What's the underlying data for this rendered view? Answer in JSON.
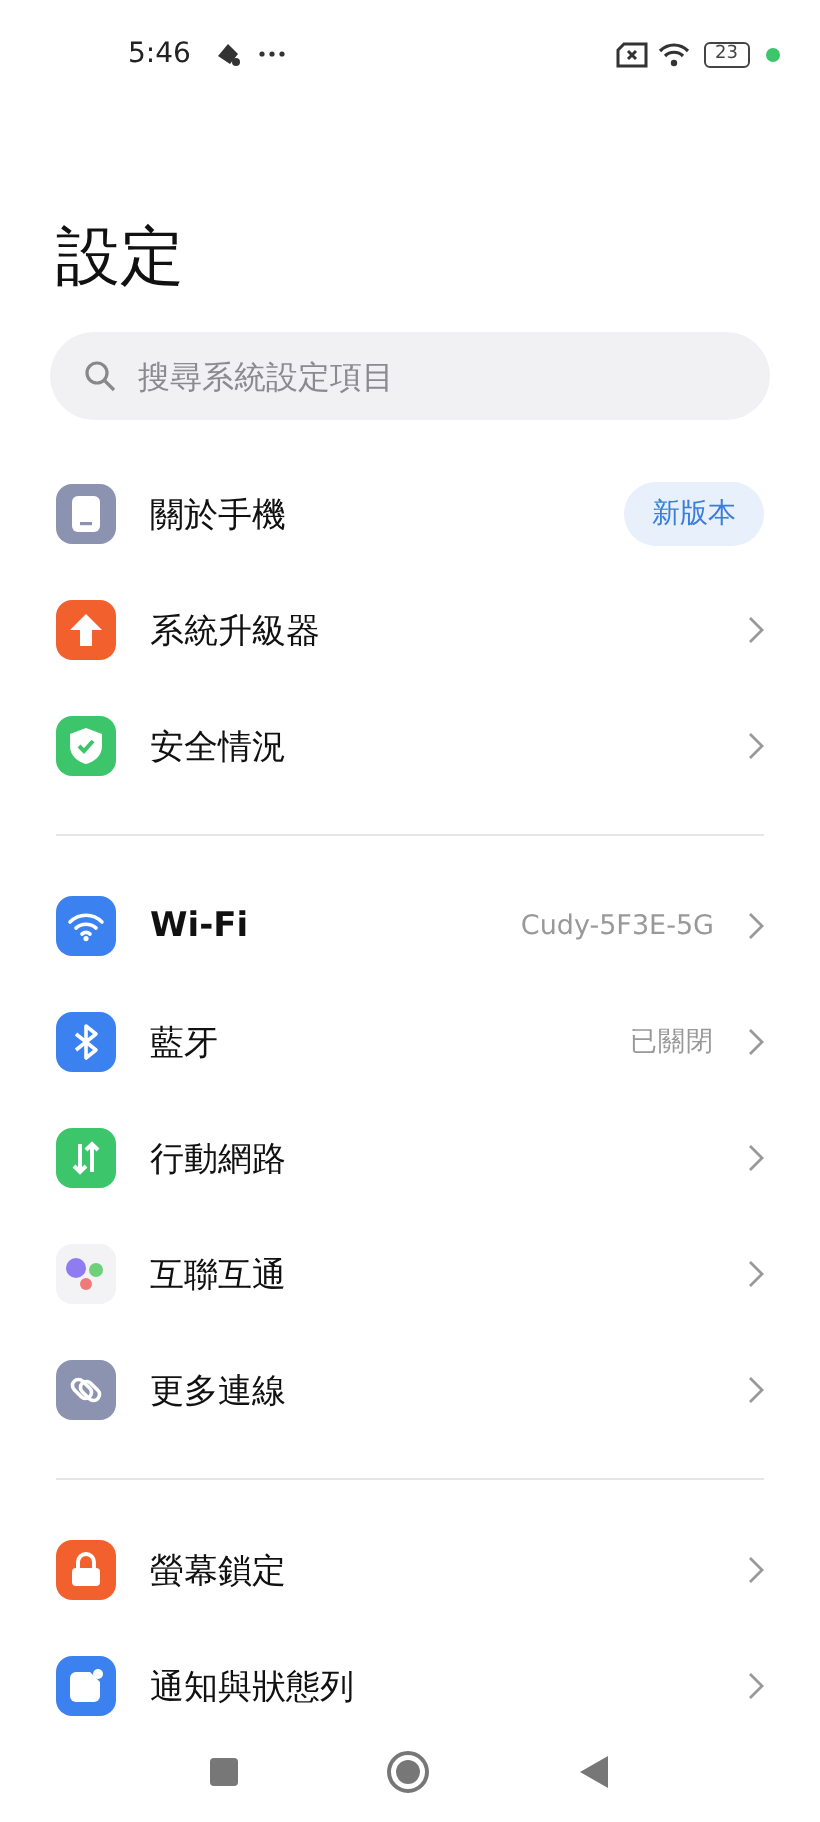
{
  "status_bar": {
    "time": "5:46",
    "battery": "23"
  },
  "title": "設定",
  "search": {
    "placeholder": "搜尋系統設定項目"
  },
  "sections": [
    {
      "items": [
        {
          "kind": "phone",
          "color": "#8c93b0",
          "label": "關於手機",
          "bold": false,
          "badge": "新版本"
        },
        {
          "kind": "upload",
          "color": "#f2602e",
          "label": "系統升級器",
          "bold": false
        },
        {
          "kind": "shield",
          "color": "#3cc56a",
          "label": "安全情況",
          "bold": false
        }
      ]
    },
    {
      "items": [
        {
          "kind": "wifi",
          "color": "#3b82f0",
          "label": "Wi-Fi",
          "bold": true,
          "value": "Cudy-5F3E-5G"
        },
        {
          "kind": "bluetooth",
          "color": "#3b82f0",
          "label": "藍牙",
          "bold": false,
          "value": "已關閉"
        },
        {
          "kind": "mobile",
          "color": "#3cc56a",
          "label": "行動網路",
          "bold": false
        },
        {
          "kind": "interconnect",
          "color": "#f3f3f5",
          "label": "互聯互通",
          "bold": false
        },
        {
          "kind": "connection",
          "color": "#8c93b0",
          "label": "更多連線",
          "bold": false
        }
      ]
    },
    {
      "items": [
        {
          "kind": "lock",
          "color": "#f2602e",
          "label": "螢幕鎖定",
          "bold": false
        },
        {
          "kind": "notification",
          "color": "#3b82f0",
          "label": "通知與狀態列",
          "bold": false
        }
      ]
    }
  ],
  "nav": [
    {
      "kind": "recents"
    },
    {
      "kind": "home"
    },
    {
      "kind": "back"
    }
  ]
}
